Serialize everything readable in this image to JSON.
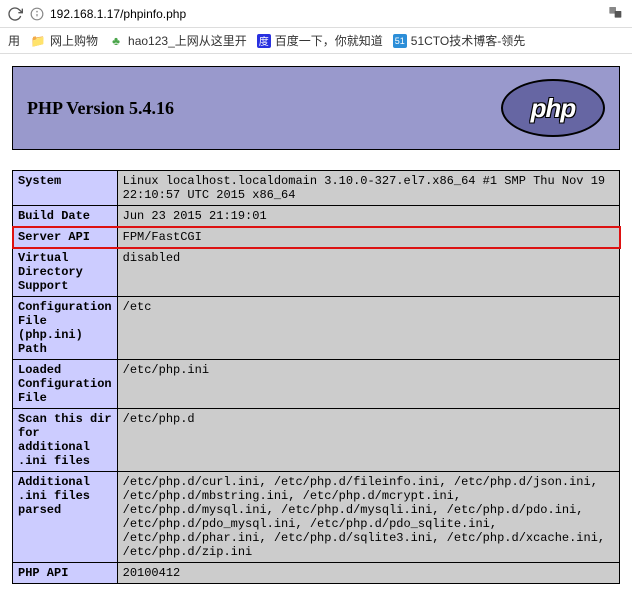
{
  "browser": {
    "url": "192.168.1.17/phpinfo.php"
  },
  "bookmarks": {
    "app": "用",
    "shopping": "网上购物",
    "hao123": "hao123_上网从这里开",
    "baidu": "百度一下，你就知道",
    "cto": "51CTO技术博客-领先"
  },
  "header": {
    "title": "PHP Version 5.4.16",
    "logo": "php"
  },
  "rows": {
    "system": {
      "label": "System",
      "value": "Linux localhost.localdomain 3.10.0-327.el7.x86_64 #1 SMP Thu Nov 19 22:10:57 UTC 2015 x86_64"
    },
    "build_date": {
      "label": "Build Date",
      "value": "Jun 23 2015 21:19:01"
    },
    "server_api": {
      "label": "Server API",
      "value": "FPM/FastCGI"
    },
    "vds": {
      "label": "Virtual Directory Support",
      "value": "disabled"
    },
    "cfg_path": {
      "label": "Configuration File (php.ini) Path",
      "value": "/etc"
    },
    "loaded_cfg": {
      "label": "Loaded Configuration File",
      "value": "/etc/php.ini"
    },
    "scan_dir": {
      "label": "Scan this dir for additional .ini files",
      "value": "/etc/php.d"
    },
    "additional": {
      "label": "Additional .ini files parsed",
      "value": "/etc/php.d/curl.ini, /etc/php.d/fileinfo.ini, /etc/php.d/json.ini, /etc/php.d/mbstring.ini, /etc/php.d/mcrypt.ini, /etc/php.d/mysql.ini, /etc/php.d/mysqli.ini, /etc/php.d/pdo.ini, /etc/php.d/pdo_mysql.ini, /etc/php.d/pdo_sqlite.ini, /etc/php.d/phar.ini, /etc/php.d/sqlite3.ini, /etc/php.d/xcache.ini, /etc/php.d/zip.ini"
    },
    "php_api": {
      "label": "PHP API",
      "value": "20100412"
    }
  }
}
